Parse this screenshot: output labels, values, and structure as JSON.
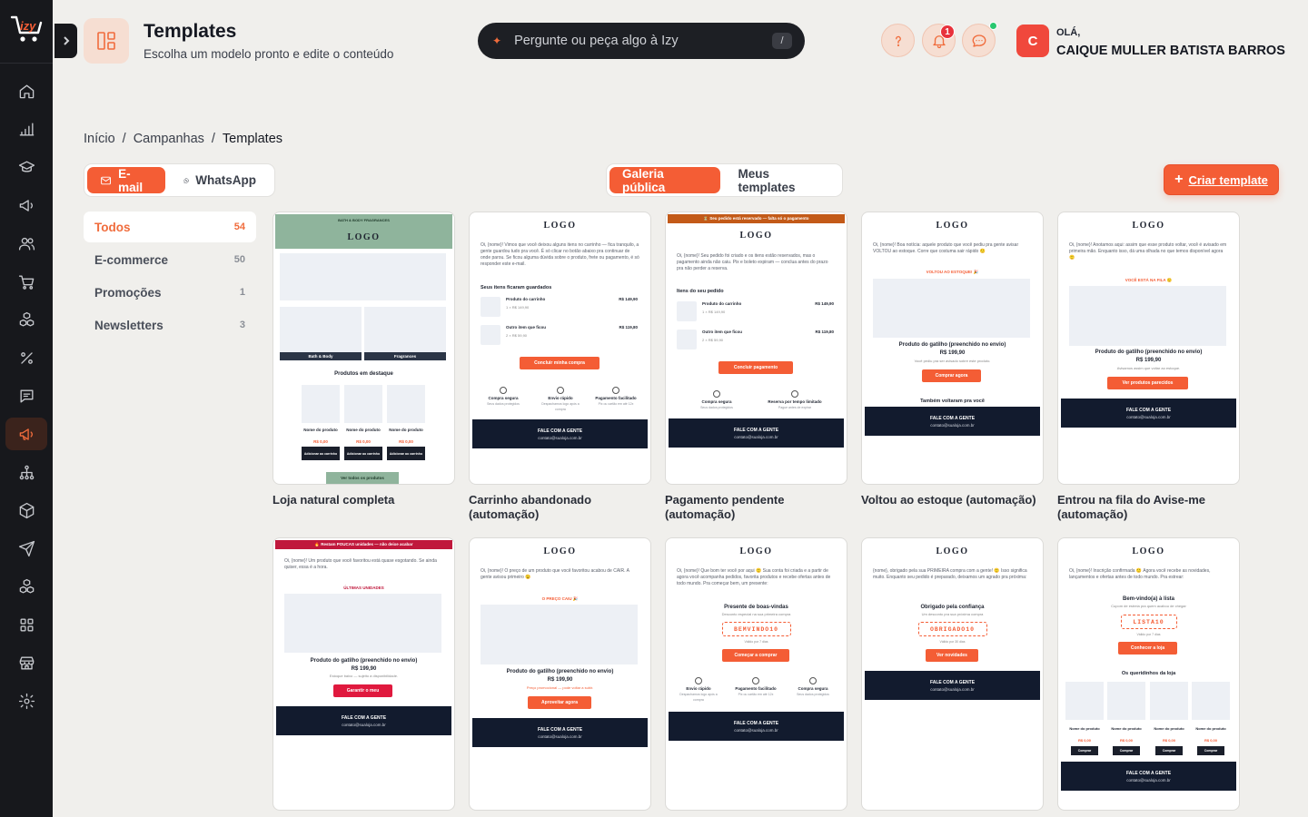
{
  "brand": {
    "name": "izy",
    "accent": "#f45d35",
    "sidebar_bg": "#17181c"
  },
  "sidebar": {
    "items": [
      "home-icon",
      "bar-chart-icon",
      "graduation-cap-icon",
      "megaphone-icon",
      "users-icon",
      "shopping-cart-icon",
      "boxes-icon",
      "percent-icon",
      "message-square-icon",
      "campaigns-icon",
      "hierarchy-icon",
      "package-icon",
      "send-icon",
      "boxes-alt-icon",
      "grid-icon",
      "store-icon",
      "settings-icon"
    ],
    "active": "campaigns-icon"
  },
  "header": {
    "title": "Templates",
    "subtitle": "Escolha um modelo pronto e edite o conteúdo",
    "ask_placeholder": "Pergunte ou peça algo à Izy",
    "ask_shortcut": "/",
    "notifications_count": "1"
  },
  "user": {
    "greeting": "OLÁ,",
    "name": "CAIQUE MULLER BATISTA BARROS",
    "initial": "C"
  },
  "breadcrumb": {
    "items": [
      "Início",
      "Campanhas",
      "Templates"
    ],
    "sep": "/"
  },
  "channel_tabs": {
    "email": "E-mail",
    "whatsapp": "WhatsApp",
    "active": "email"
  },
  "gallery_tabs": {
    "public": "Galeria pública",
    "mine": "Meus templates",
    "active": "public"
  },
  "create_button": {
    "label": "Criar template",
    "icon": "+"
  },
  "categories": [
    {
      "label": "Todos",
      "count": "54"
    },
    {
      "label": "E-commerce",
      "count": "50"
    },
    {
      "label": "Promoções",
      "count": "1"
    },
    {
      "label": "Newsletters",
      "count": "3"
    }
  ],
  "templates": [
    {
      "name": "Loja natural completa",
      "mini": {
        "topnav": "BATH & BODY    FRAGRANCES",
        "logo": "LOGO",
        "cat1": "Bath & Body",
        "cat2": "Fragrances",
        "section": "Produtos em destaque",
        "prod": "Nome do produto",
        "price": "R$ 0,00",
        "add": "Adicionar ao carrinho",
        "all": "Ver todos os produtos"
      }
    },
    {
      "name": "Carrinho abandonado (automação)",
      "mini": {
        "logo": "LOGO",
        "text": "Oi, {nome}! Vimos que você deixou alguns itens no carrinho — fica tranquilo, a gente guardou tudo pra você. É só clicar no botão abaixo pra continuar de onde parou. Se ficou alguma dúvida sobre o produto, frete ou pagamento, é só responder este e-mail.",
        "section": "Seus itens ficaram guardados",
        "p1": "Produto do carrinho",
        "p1q": "1 × R$ 149,90",
        "p1v": "R$ 149,90",
        "p2": "Outro item que ficou",
        "p2q": "2 × R$ 59,90",
        "p2v": "R$ 119,80",
        "cta": "Concluir minha compra",
        "f1": "Compra segura",
        "f1s": "Seus dados protegidos",
        "f2": "Envio rápido",
        "f2s": "Despachamos logo após a compra",
        "f3": "Pagamento facilitado",
        "f3s": "Pix ou cartão em até 12x",
        "foot": "FALE COM A GENTE",
        "mail": "contato@sualoja.com.br"
      }
    },
    {
      "name": "Pagamento pendente (automação)",
      "mini": {
        "bar": "⏳ Seu pedido está reservado — falta só o pagamento",
        "logo": "LOGO",
        "text": "Oi, {nome}! Seu pedido foi criado e os itens estão reservados, mas o pagamento ainda não caiu. Pix e boleto expiram — conclua antes do prazo pra não perder a reserva.",
        "section": "Itens do seu pedido",
        "p1": "Produto do carrinho",
        "p1q": "1 × R$ 149,90",
        "p1v": "R$ 149,90",
        "p2": "Outro item que ficou",
        "p2q": "2 × R$ 59,90",
        "p2v": "R$ 119,80",
        "cta": "Concluir pagamento",
        "f1": "Compra segura",
        "f1s": "Seus dados protegidos",
        "f2": "Reserva por tempo limitado",
        "f2s": "Pague antes de expirar",
        "foot": "FALE COM A GENTE",
        "mail": "contato@sualoja.com.br"
      }
    },
    {
      "name": "Voltou ao estoque (automação)",
      "mini": {
        "logo": "LOGO",
        "text": "Oi, {nome}! Boa notícia: aquele produto que você pediu pra gente avisar VOLTOU ao estoque. Corre que costuma sair rápido 🙂",
        "tag": "VOLTOU AO ESTOQUE! 🎉",
        "prod": "Produto do gatilho (preenchido no envio)",
        "price": "R$ 199,90",
        "sub": "Você pediu pra ser avisado sobre este produto.",
        "cta": "Comprar agora",
        "also": "Também voltaram pra você",
        "foot": "FALE COM A GENTE",
        "mail": "contato@sualoja.com.br"
      }
    },
    {
      "name": "Entrou na fila do Avise-me (automação)",
      "mini": {
        "logo": "LOGO",
        "text": "Oi, {nome}! Anotamos aqui: assim que esse produto voltar, você é avisado em primeira mão. Enquanto isso, dá uma olhada no que temos disponível agora 🙂",
        "tag": "VOCÊ ESTÁ NA FILA 🙂",
        "prod": "Produto do gatilho (preenchido no envio)",
        "price": "R$ 199,90",
        "sub": "Avisamos assim que voltar ao estoque.",
        "cta": "Ver produtos parecidos",
        "foot": "FALE COM A GENTE",
        "mail": "contato@sualoja.com.br"
      }
    },
    {
      "name": "",
      "mini": {
        "bar": "🔥 Restam POUCAS unidades — não deixe acabar",
        "text": "Oi, {nome}! Um produto que você favoritou está quase esgotando. Se ainda quiser, essa é a hora.",
        "tag": "ÚLTIMAS UNIDADES",
        "prod": "Produto do gatilho (preenchido no envio)",
        "price": "R$ 199,90",
        "sub": "Estoque baixo — sujeito à disponibilidade.",
        "cta": "Garantir o meu",
        "foot": "FALE COM A GENTE",
        "mail": "contato@sualoja.com.br"
      }
    },
    {
      "name": "",
      "mini": {
        "logo": "LOGO",
        "text": "Oi, {nome}! O preço de um produto que você favoritou acabou de CAIR. A gente avisou primeiro 😉",
        "tag": "O PREÇO CAIU 🎉",
        "prod": "Produto do gatilho (preenchido no envio)",
        "price": "R$ 199,90",
        "sub": "Preço promocional — pode voltar a subir.",
        "cta": "Aproveitar agora",
        "foot": "FALE COM A GENTE",
        "mail": "contato@sualoja.com.br"
      }
    },
    {
      "name": "",
      "mini": {
        "logo": "LOGO",
        "text": "Oi, {nome}! Que bom ter você por aqui 🙂 Sua conta foi criada e a partir de agora você acompanha pedidos, favorita produtos e recebe ofertas antes de todo mundo. Pra começar bem, um presente:",
        "section": "Presente de boas-vindas",
        "sub": "Desconto especial na sua primeira compra",
        "code": "BEMVINDO10",
        "valid": "Válido por 7 dias",
        "cta": "Começar a comprar",
        "f1": "Envio rápido",
        "f1s": "Despachamos logo após a compra",
        "f2": "Pagamento facilitado",
        "f2s": "Pix ou cartão em até 12x",
        "f3": "Compra segura",
        "f3s": "Seus dados protegidos",
        "foot": "FALE COM A GENTE",
        "mail": "contato@sualoja.com.br"
      }
    },
    {
      "name": "",
      "mini": {
        "logo": "LOGO",
        "text": "{nome}, obrigado pela sua PRIMEIRA compra com a gente! 🙂 Isso significa muito. Enquanto seu pedido é preparado, deixamos um agrado pra próxima:",
        "section": "Obrigado pela confiança",
        "sub": "Um desconto pra sua próxima compra",
        "code": "OBRIGADO10",
        "valid": "Válido por 30 dias",
        "cta": "Ver novidades",
        "foot": "FALE COM A GENTE",
        "mail": "contato@sualoja.com.br"
      }
    },
    {
      "name": "",
      "mini": {
        "logo": "LOGO",
        "text": "Oi, {nome}! Inscrição confirmada 🙂 Agora você recebe as novidades, lançamentos e ofertas antes de todo mundo. Pra estrear:",
        "section": "Bem-vindo(a) à lista",
        "sub": "Cupom de estreia pra quem acabou de chegar",
        "code": "LISTA10",
        "valid": "Válido por 7 dias",
        "cta": "Conhecer a loja",
        "fav": "Os queridinhos da loja",
        "prod": "Nome do produto",
        "price": "R$ 0,00",
        "buy": "Comprar",
        "foot": "FALE COM A GENTE",
        "mail": "contato@sualoja.com.br"
      }
    }
  ]
}
